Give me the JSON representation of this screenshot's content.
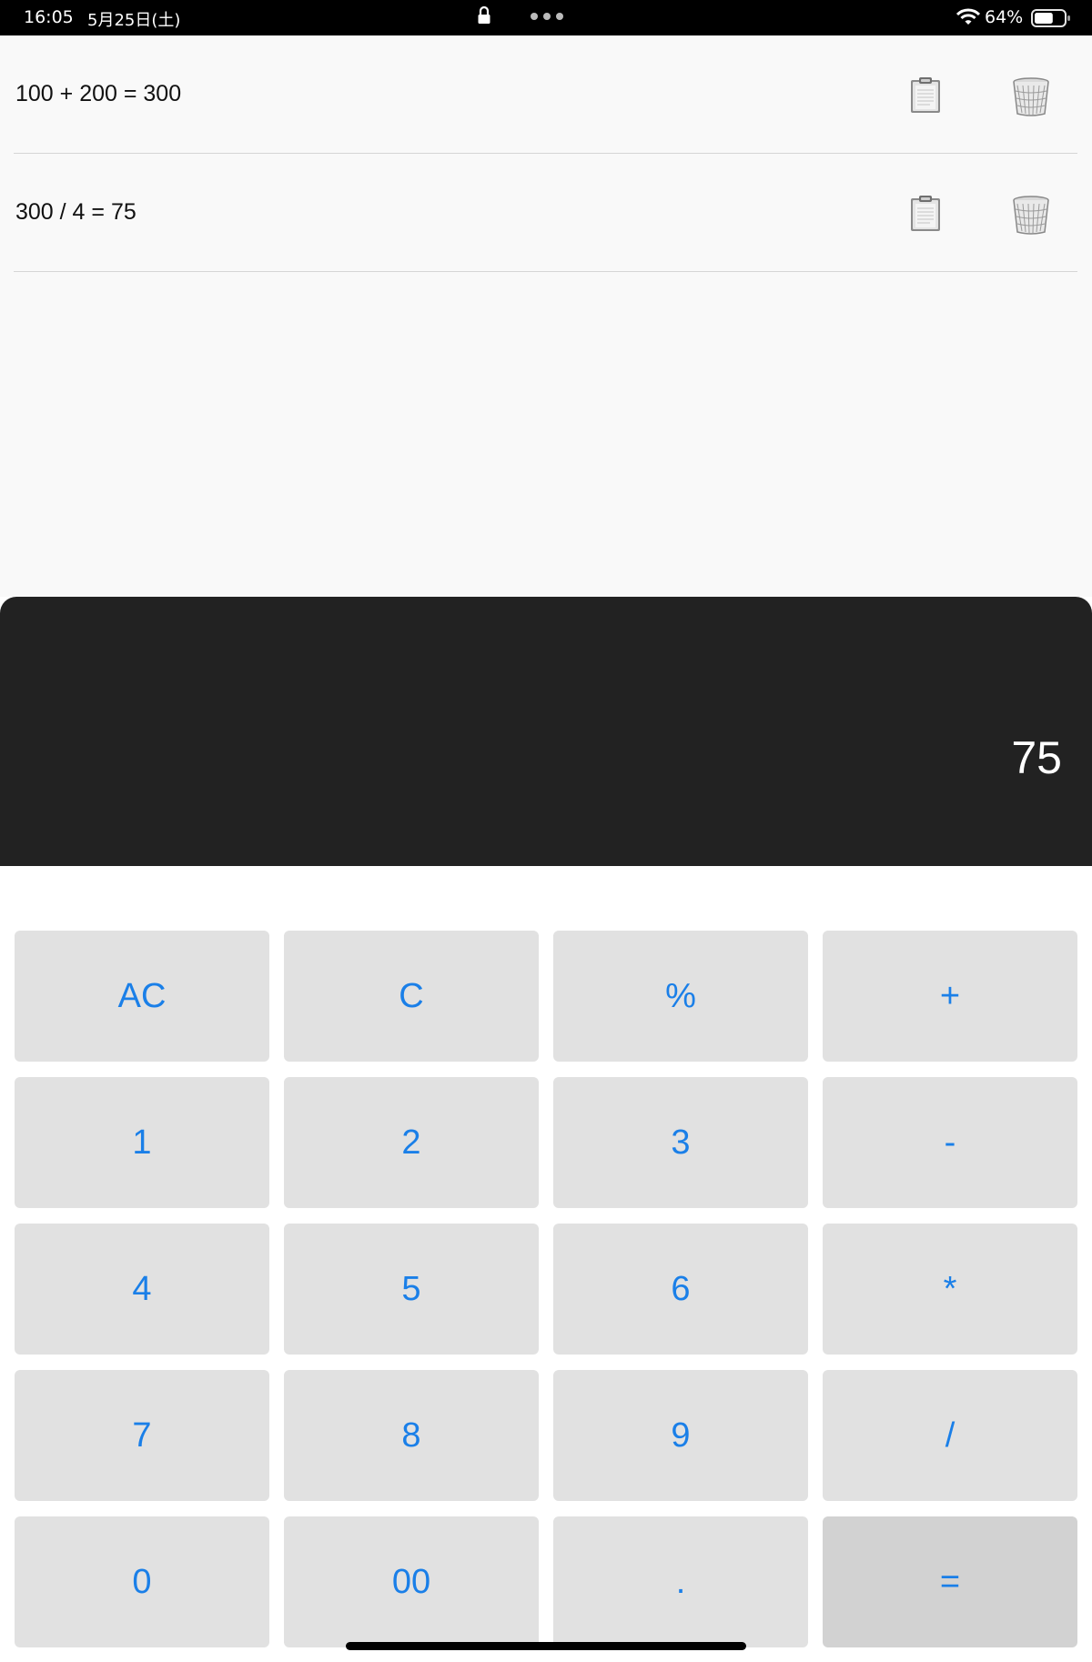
{
  "status_bar": {
    "time": "16:05",
    "date": "5月25日(土)",
    "battery_percent": "64%",
    "battery_level": 0.64,
    "icons": [
      "lock-icon",
      "more-dots-icon",
      "wifi-icon",
      "battery-icon"
    ]
  },
  "history": [
    {
      "expression": "100 + 200 = 300"
    },
    {
      "expression": "300 / 4 = 75"
    }
  ],
  "display": {
    "value": "75"
  },
  "keypad": {
    "rows": [
      [
        "AC",
        "C",
        "%",
        "+"
      ],
      [
        "1",
        "2",
        "3",
        "-"
      ],
      [
        "4",
        "5",
        "6",
        "*"
      ],
      [
        "7",
        "8",
        "9",
        "/"
      ],
      [
        "0",
        "00",
        ".",
        "="
      ]
    ]
  },
  "colors": {
    "accent": "#1a7fe8",
    "display_bg": "#222222",
    "key_bg": "#e1e1e1",
    "equals_bg": "#d2d2d2",
    "history_bg": "#f9f9f9"
  }
}
